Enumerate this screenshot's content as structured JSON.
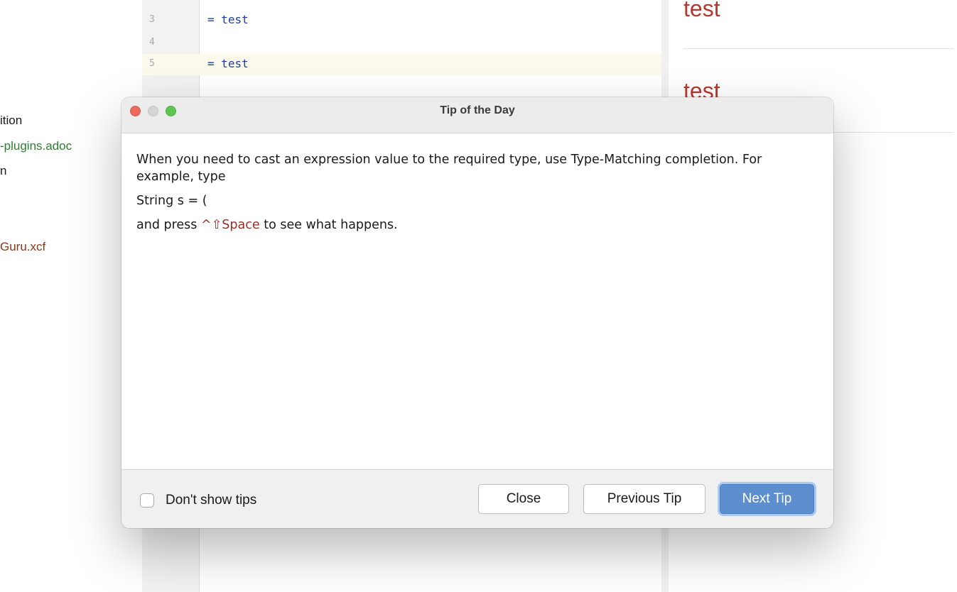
{
  "project_tree": {
    "items": [
      {
        "label": "ition",
        "color": "#1a1a1a"
      },
      {
        "label": "-plugins.adoc",
        "color": "#2e7d32"
      },
      {
        "label": "n",
        "color": "#1a1a1a"
      },
      {
        "label": "Guru.xcf",
        "color": "#8b3a1a"
      }
    ]
  },
  "editor": {
    "lines": [
      {
        "number": "3",
        "code": "= test"
      },
      {
        "number": "4",
        "code": ""
      },
      {
        "number": "5",
        "code": "= test"
      }
    ]
  },
  "preview": {
    "headings": [
      "test",
      "test"
    ]
  },
  "dialog": {
    "title": "Tip of the Day",
    "tip": {
      "paragraph1": "When you need to cast an expression value to the required type, use Type-Matching completion. For example, type",
      "paragraph2": "String s = (",
      "paragraph3_before": "and press ",
      "paragraph3_shortcut": "^⇧Space",
      "paragraph3_after": " to see what happens."
    },
    "footer": {
      "dont_show_label": "Don't show tips",
      "dont_show_checked": false,
      "close_label": "Close",
      "previous_label": "Previous Tip",
      "next_label": "Next Tip"
    }
  },
  "colors": {
    "accent_button": "#5d8fcf",
    "shortcut_text": "#9e2b25",
    "preview_heading": "#b5382c"
  }
}
